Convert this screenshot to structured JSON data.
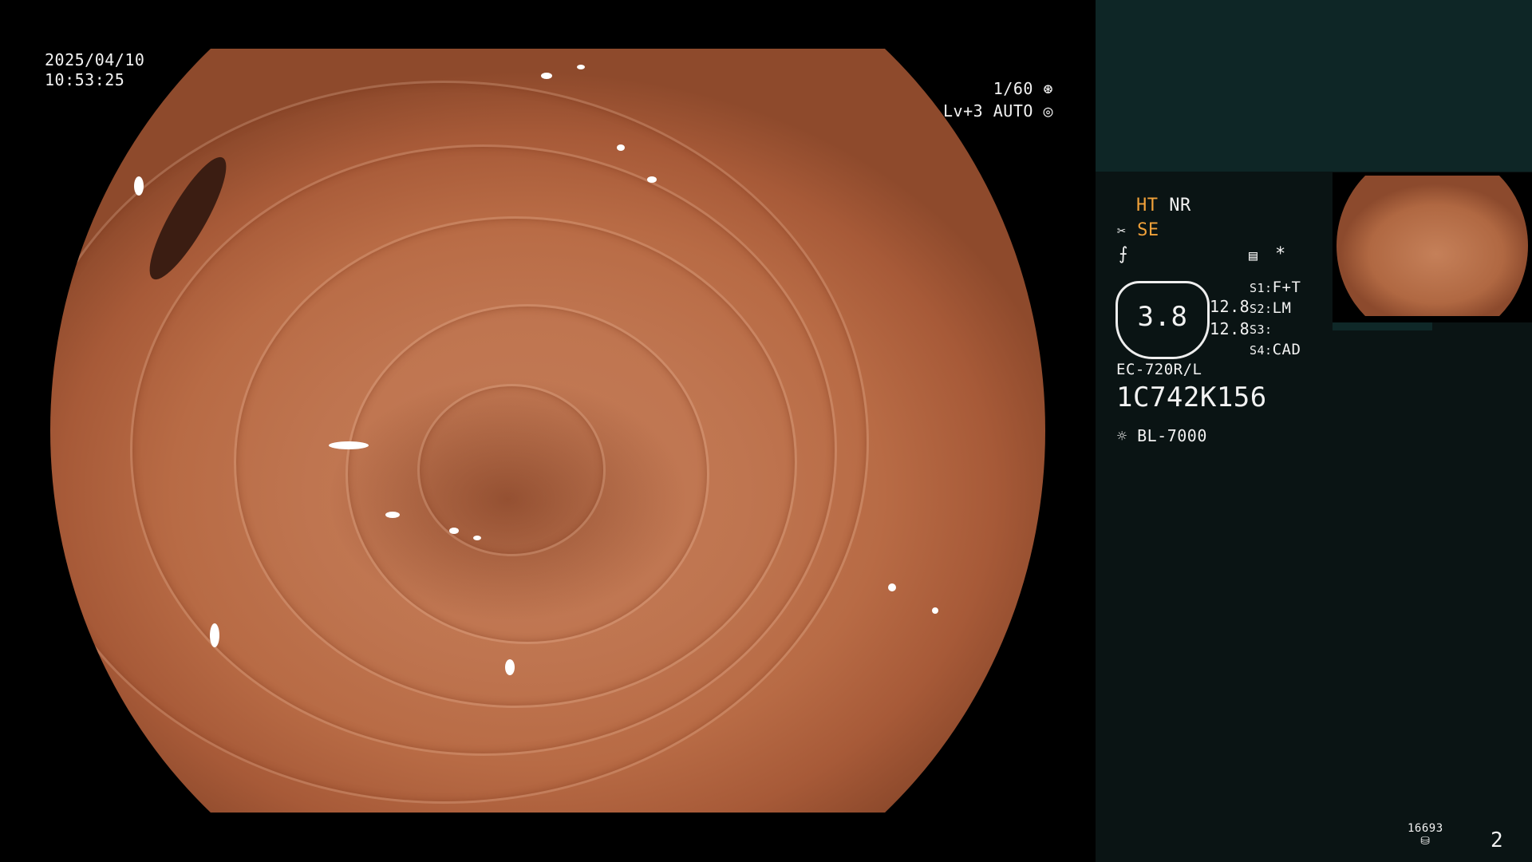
{
  "datetime": {
    "date": "2025/04/10",
    "time": "10:53:25"
  },
  "camera": {
    "shutter": "1/60",
    "level": "Lv+3",
    "mode": "AUTO"
  },
  "settings": {
    "ht": "HT",
    "nr": "NR",
    "se": "SE",
    "zoom_value": "3.8",
    "values": [
      "12.8",
      "12.8"
    ],
    "switches": [
      {
        "key": "S1:",
        "value": "F+T"
      },
      {
        "key": "S2:",
        "value": "LM"
      },
      {
        "key": "S3:",
        "value": ""
      },
      {
        "key": "S4:",
        "value": "CAD"
      }
    ],
    "asterisk": "*"
  },
  "scope": {
    "model": "EC-720R/L",
    "serial": "1C742K156"
  },
  "light_source": "BL-7000",
  "storage": {
    "count": "16693",
    "image_number": "2"
  },
  "icons": [
    "aperture-icon",
    "auto-exposure-icon",
    "scissors-icon",
    "tool-icon",
    "menu-icon",
    "sun-icon",
    "disk-icon"
  ],
  "colors": {
    "accent": "#f2a23a",
    "panel": "#0a1414",
    "panel_top": "#0e2626"
  }
}
